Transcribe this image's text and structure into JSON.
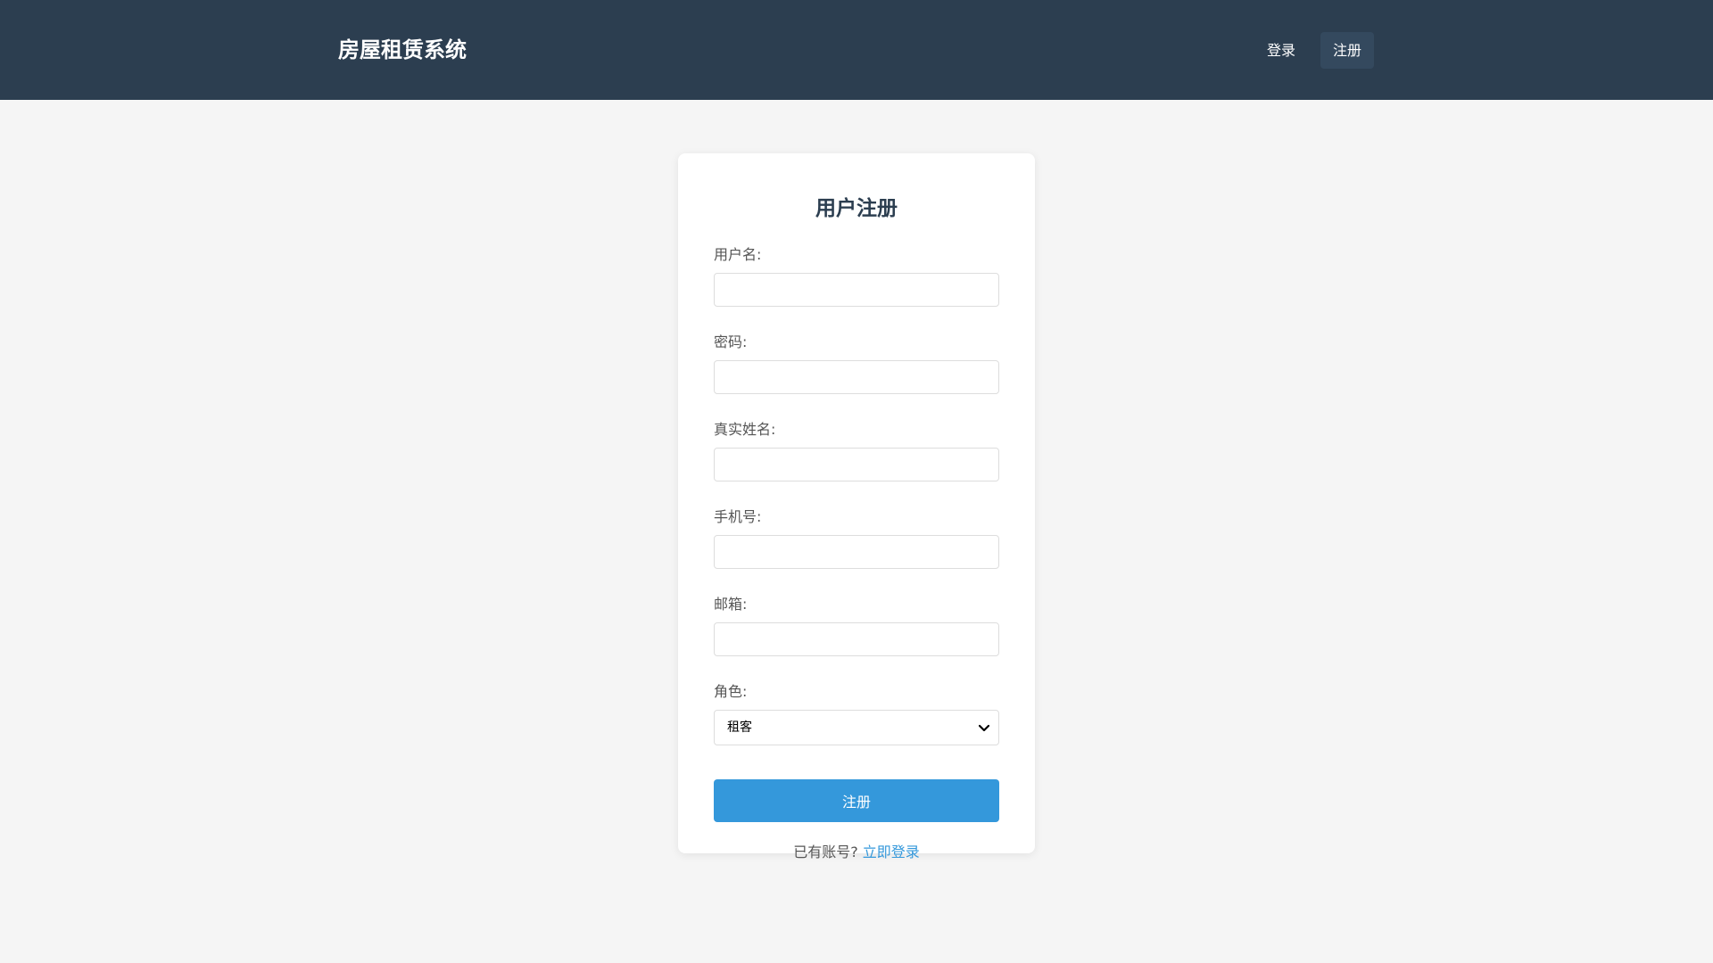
{
  "header": {
    "brand": "房屋租赁系统",
    "nav": [
      {
        "label": "登录",
        "active": false
      },
      {
        "label": "注册",
        "active": true
      }
    ]
  },
  "form": {
    "title": "用户注册",
    "fields": [
      {
        "label": "用户名:",
        "value": ""
      },
      {
        "label": "密码:",
        "value": ""
      },
      {
        "label": "真实姓名:",
        "value": ""
      },
      {
        "label": "手机号:",
        "value": ""
      },
      {
        "label": "邮箱:",
        "value": ""
      }
    ],
    "role": {
      "label": "角色:",
      "selected": "租客"
    },
    "submit_label": "注册",
    "footer_text": "已有账号?",
    "footer_link": "立即登录"
  },
  "colors": {
    "header_bg": "#2c3e50",
    "nav_active_bg": "#34495e",
    "accent": "#3498db",
    "page_bg": "#f5f5f5"
  }
}
